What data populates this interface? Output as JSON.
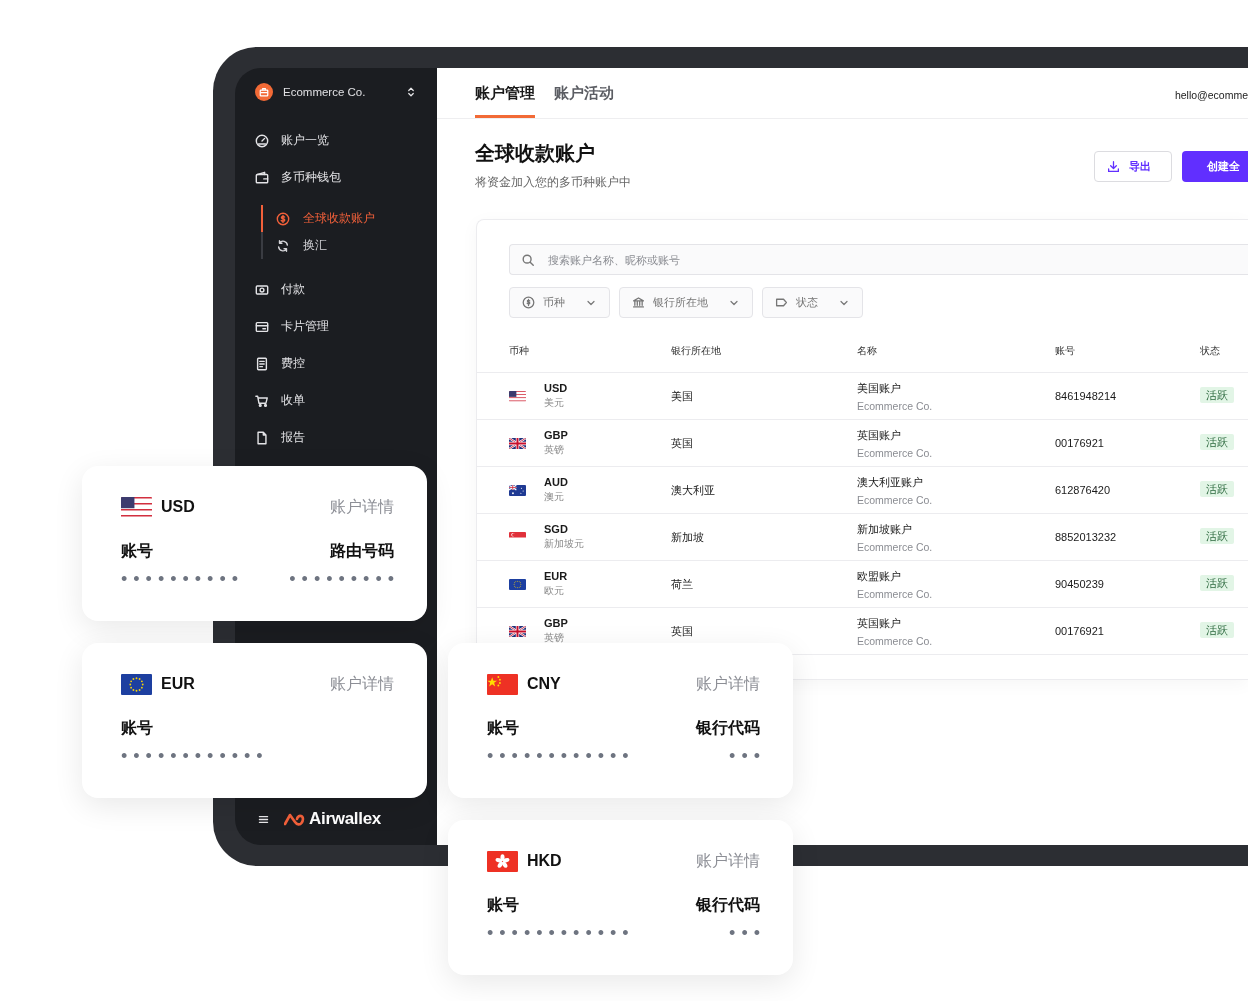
{
  "sidebar": {
    "company": "Ecommerce Co.",
    "items": [
      {
        "label": "账户一览",
        "selected": false
      },
      {
        "label": "多币种钱包",
        "selected": false,
        "children": [
          {
            "label": "全球收款账户",
            "selected": true
          },
          {
            "label": "换汇",
            "selected": false
          }
        ]
      },
      {
        "label": "付款",
        "selected": false
      },
      {
        "label": "卡片管理",
        "selected": false
      },
      {
        "label": "费控",
        "selected": false
      },
      {
        "label": "收单",
        "selected": false
      },
      {
        "label": "报告",
        "selected": false
      }
    ],
    "logo": "Airwallex"
  },
  "main": {
    "tabs": [
      {
        "label": "账户管理",
        "selected": true
      },
      {
        "label": "账户活动",
        "selected": false
      }
    ],
    "user_email": "hello@ecomme",
    "title": "全球收款账户",
    "subtitle": "将资金加入您的多币种账户中",
    "buttons": [
      {
        "label": "导出",
        "kind": "outline"
      },
      {
        "label": "创建全",
        "kind": "primary"
      }
    ],
    "search": {
      "placeholder": "搜索账户名称、昵称或账号"
    },
    "filters": [
      "币种",
      "银行所在地",
      "状态"
    ],
    "table": {
      "columns": [
        "币种",
        "银行所在地",
        "名称",
        "账号",
        "状态"
      ],
      "rows": [
        {
          "code": "USD",
          "currency": "美元",
          "location": "美国",
          "name": "美国账户",
          "company": "Ecommerce Co.",
          "number": "8461948214",
          "status": "活跃"
        },
        {
          "code": "GBP",
          "currency": "英镑",
          "location": "英国",
          "name": "英国账户",
          "company": "Ecommerce Co.",
          "number": "00176921",
          "status": "活跃"
        },
        {
          "code": "AUD",
          "currency": "澳元",
          "location": "澳大利亚",
          "name": "澳大利亚账户",
          "company": "Ecommerce Co.",
          "number": "612876420",
          "status": "活跃"
        },
        {
          "code": "SGD",
          "currency": "新加坡元",
          "location": "新加坡",
          "name": "新加坡账户",
          "company": "Ecommerce Co.",
          "number": "8852013232",
          "status": "活跃"
        },
        {
          "code": "EUR",
          "currency": "欧元",
          "location": "荷兰",
          "name": "欧盟账户",
          "company": "Ecommerce Co.",
          "number": "90450239",
          "status": "活跃"
        },
        {
          "code": "GBP",
          "currency": "英镑",
          "location": "英国",
          "name": "英国账户",
          "company": "Ecommerce Co.",
          "number": "00176921",
          "status": "活跃"
        }
      ]
    }
  },
  "cards": [
    {
      "code": "USD",
      "link": "账户详情",
      "fields": [
        {
          "label": "账号",
          "value": "••••••••••"
        },
        {
          "label": "路由号码",
          "value": "•••••••••"
        }
      ]
    },
    {
      "code": "EUR",
      "link": "账户详情",
      "fields": [
        {
          "label": "账号",
          "value": "••••••••••••"
        }
      ]
    },
    {
      "code": "CNY",
      "link": "账户详情",
      "fields": [
        {
          "label": "账号",
          "value": "••••••••••••"
        },
        {
          "label": "银行代码",
          "value": "•••"
        }
      ]
    },
    {
      "code": "HKD",
      "link": "账户详情",
      "fields": [
        {
          "label": "账号",
          "value": "••••••••••••"
        },
        {
          "label": "银行代码",
          "value": "•••"
        }
      ]
    }
  ]
}
